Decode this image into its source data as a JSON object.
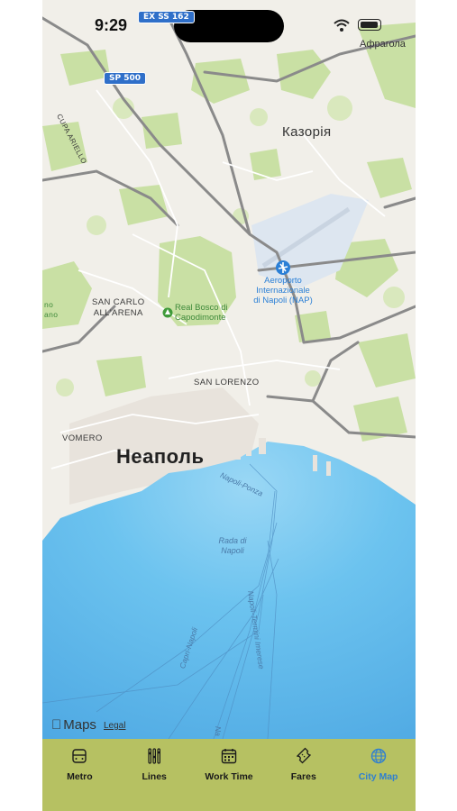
{
  "status_bar": {
    "time": "9:29",
    "carrier": "Афрагола"
  },
  "map": {
    "road_shields": [
      "EX SS 162",
      "SP 500"
    ],
    "labels": {
      "city": "Неаполь",
      "town": "Казорія",
      "district_san_carlo": "SAN CARLO\nALL'ARENA",
      "district_san_lorenzo": "SAN LORENZO",
      "district_vomero": "VOMERO",
      "street_left": "CUPA ARIELLO",
      "left_edge": "no\nano",
      "poi_park": "Real Bosco di\nCapodimonte",
      "airport": "Aeroporto\nInternazionale\ndi Napoli (NAP)",
      "water": "Rada di\nNapoli",
      "route_ponza": "Napoli-Ponza",
      "route_capri": "Capri-Napoli",
      "route_termini": "Napoli-Termini Imerese",
      "route_bottom": "Na"
    },
    "attribution": {
      "brand": "Maps",
      "legal": "Legal"
    },
    "colors": {
      "land": "#f1efe9",
      "park": "#c9e0a4",
      "water": "#6cc3ef",
      "airport": "#dde6f0",
      "road": "#8a8a8a"
    }
  },
  "tabbar": {
    "items": [
      {
        "label": "Metro",
        "icon": "metro-icon"
      },
      {
        "label": "Lines",
        "icon": "lines-icon"
      },
      {
        "label": "Work Time",
        "icon": "calendar-icon"
      },
      {
        "label": "Fares",
        "icon": "ticket-icon"
      },
      {
        "label": "City Map",
        "icon": "globe-icon"
      }
    ],
    "active": "City Map",
    "colors": {
      "background": "#b6c162",
      "active": "#2f7fd0"
    }
  }
}
